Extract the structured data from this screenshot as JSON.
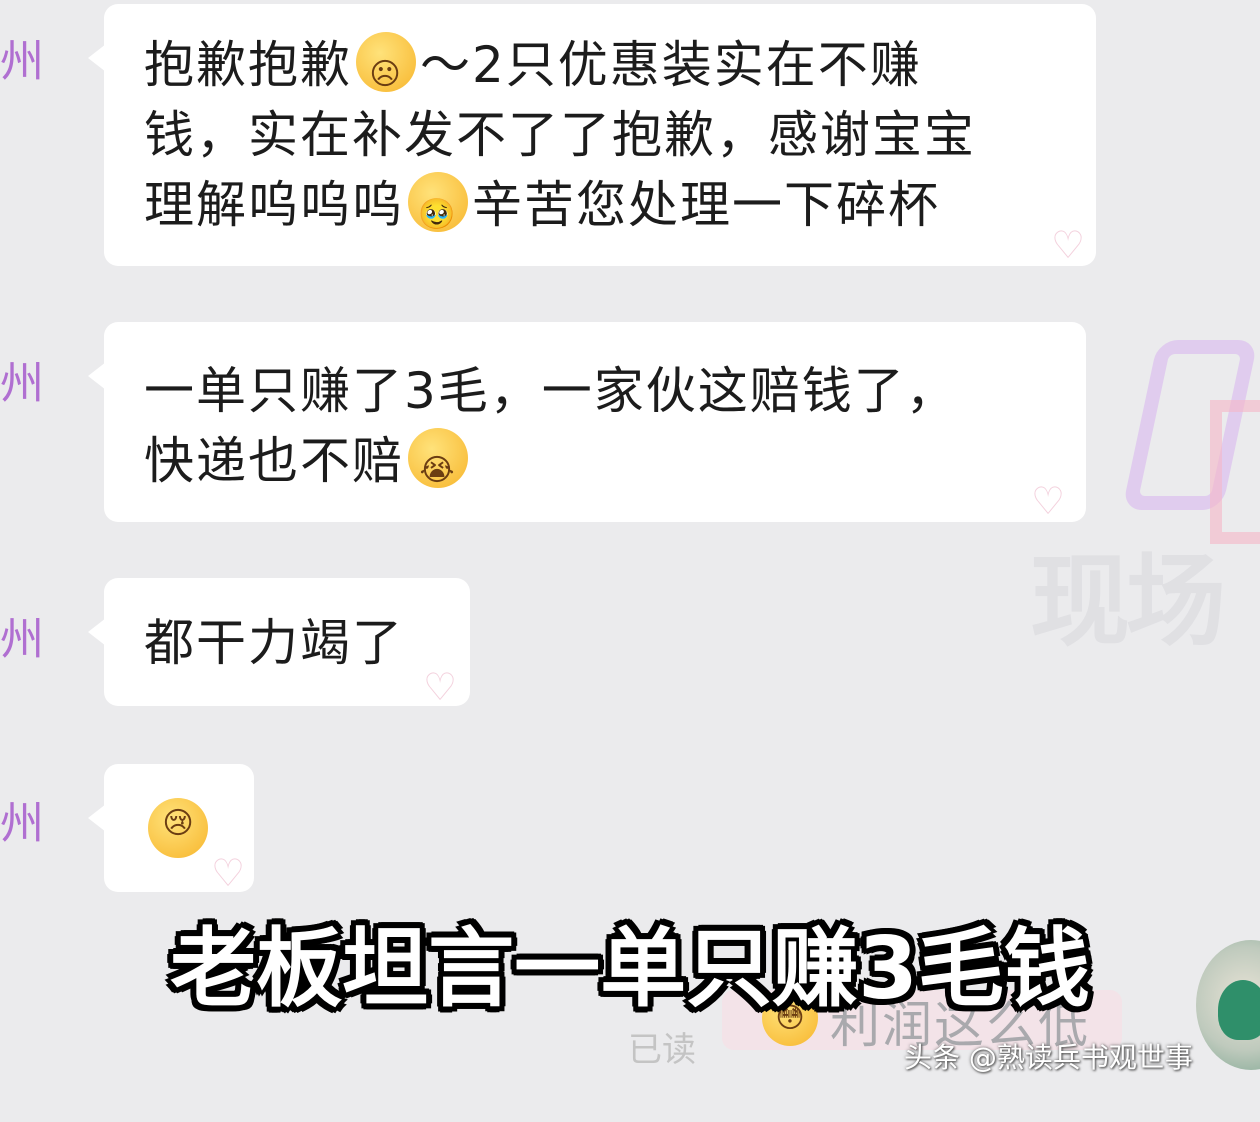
{
  "messages": [
    {
      "sender_fragment": "州",
      "parts": [
        "抱歉抱歉",
        "～2只优惠装实在不赚\n钱，实在补发不了了抱歉，感谢宝宝\n理解呜呜呜",
        "辛苦您处理一下碎杯"
      ],
      "emojis": [
        "frown-emoji",
        "teary-smile-emoji"
      ]
    },
    {
      "sender_fragment": "州",
      "parts": [
        "一单只赚了3毛，一家伙这赔钱了，\n快递也不赔",
        ""
      ],
      "emojis": [
        "loudly-crying-emoji"
      ]
    },
    {
      "sender_fragment": "州",
      "parts": [
        "都干力竭了"
      ],
      "emojis": []
    },
    {
      "sender_fragment": "州",
      "parts": [],
      "emojis": [
        "crying-emoji"
      ]
    }
  ],
  "caption": "老板坦言一单只赚3毛钱",
  "sent_message": {
    "text": "利润这么低",
    "emoji": "flushed-crying-emoji",
    "read_label": "已读"
  },
  "watermark": {
    "site": "头条 @熟读兵书观世事",
    "background": "现场"
  },
  "colors": {
    "background": "#ebebed",
    "bubble": "#ffffff",
    "sender": "#b06fd1",
    "caption_fill": "#ffffff",
    "caption_stroke": "#000000"
  }
}
